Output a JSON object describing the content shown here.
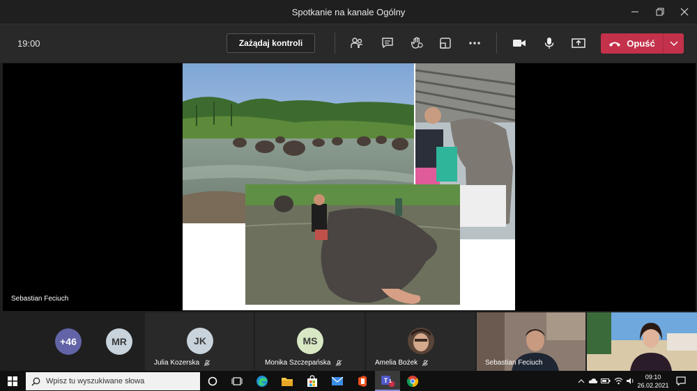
{
  "window": {
    "title": "Spotkanie na kanale Ogólny"
  },
  "toolbar": {
    "time": "19:00",
    "request_control_label": "Zażądaj kontroli",
    "leave_label": "Opuść",
    "icons": [
      "participants-icon",
      "chat-icon",
      "raise-hand-icon",
      "breakout-icon",
      "more-icon",
      "camera-icon",
      "mic-icon",
      "share-icon"
    ]
  },
  "stage": {
    "presenter_name": "Sebastian Feciuch"
  },
  "participants": {
    "overflow_count": "+46",
    "tiles": [
      {
        "initials": "MR",
        "name": "",
        "color": "#c8d3db"
      },
      {
        "initials": "JK",
        "name": "Julia Kozerska",
        "color": "#c8d3db"
      },
      {
        "initials": "MS",
        "name": "Monika Szczepańska",
        "color": "#d8e8c4"
      },
      {
        "initials": "",
        "name": "Amelia Bożek",
        "color": ""
      },
      {
        "initials": "",
        "name": "Sebastian Feciuch",
        "color": ""
      },
      {
        "initials": "",
        "name": "",
        "color": ""
      }
    ]
  },
  "taskbar": {
    "search_placeholder": "Wpisz tu wyszukiwane słowa",
    "teams_badge": "1",
    "time": "09:10",
    "date": "26.02.2021"
  },
  "colors": {
    "leave": "#c4314b",
    "overflow_avatar": "#6264a7",
    "taskbar": "#101010"
  }
}
